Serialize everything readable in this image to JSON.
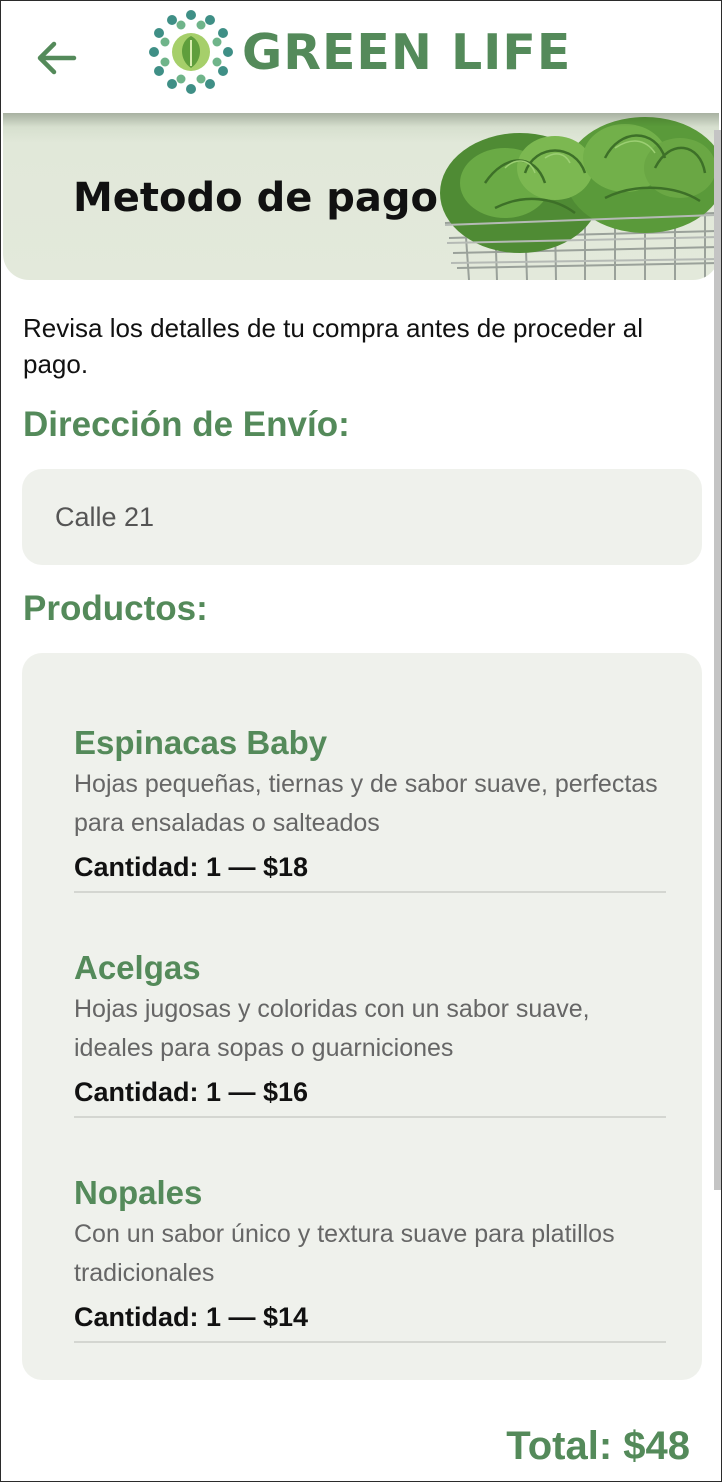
{
  "header": {
    "brand": "GREEN LIFE",
    "back_icon": "arrow-left-icon",
    "logo_icon": "leaf-mandala-logo"
  },
  "hero": {
    "title": "Metodo de pago",
    "image": "lettuce-basket-image"
  },
  "intro": "Revisa los detalles de tu compra antes de proceder al pago.",
  "address": {
    "title": "Dirección de Envío:",
    "value": "Calle 21"
  },
  "products": {
    "title": "Productos:",
    "items": [
      {
        "name": "Espinacas Baby",
        "description": "Hojas pequeñas, tiernas y de sabor suave, perfectas para ensaladas o salteados",
        "quantity": "Cantidad: 1 — $18"
      },
      {
        "name": "Acelgas",
        "description": "Hojas jugosas y coloridas con un sabor suave, ideales para sopas o guarniciones",
        "quantity": "Cantidad: 1 — $16"
      },
      {
        "name": "Nopales",
        "description": "Con un sabor único y textura suave para platillos tradicionales",
        "quantity": "Cantidad: 1 — $14"
      }
    ]
  },
  "total": "Total: $48",
  "colors": {
    "brand_green": "#548a5a",
    "card_bg": "#eff1ec",
    "hero_bg": "#e3e9db"
  }
}
